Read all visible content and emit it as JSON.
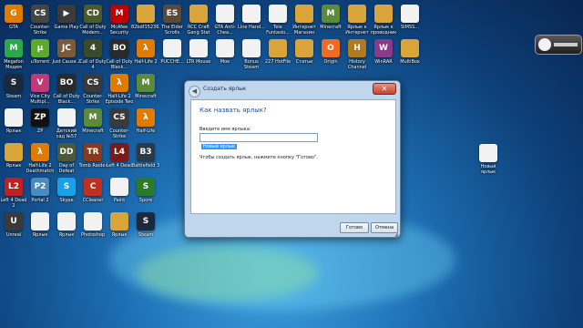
{
  "dialog": {
    "title": "Создать ярлык",
    "close_glyph": "✕",
    "back_glyph": "◀",
    "heading": "Как назвать ярлык?",
    "field_label": "Введите имя ярлыка:",
    "field_value": "Новый ярлык",
    "hint": "Чтобы создать ярлык, нажмите кнопку \"Готово\".",
    "done_label": "Готово",
    "cancel_label": "Отмена"
  },
  "colors": {
    "desktop_center": "#3fa3e0",
    "desktop_edge": "#082650",
    "dialog_frame": "#bfd6ec",
    "heading": "#1e4f94",
    "selection": "#3399ff",
    "close_button": "#c7412b"
  },
  "desktop_icons": [
    {
      "label": "GTA",
      "icon": "game-icon",
      "color": "#e07b00",
      "glyph": "G"
    },
    {
      "label": "Counter-Strike",
      "icon": "game-icon",
      "color": "#444444",
      "glyph": "CS"
    },
    {
      "label": "Game Play",
      "icon": "game-icon",
      "color": "#3b3b3b",
      "glyph": "▶"
    },
    {
      "label": "Call of Duty Modern...",
      "icon": "game-icon",
      "color": "#4a5a2a",
      "glyph": "CD"
    },
    {
      "label": "McAfee Security Sc...",
      "icon": "shield-icon",
      "color": "#c00000",
      "glyph": "M"
    },
    {
      "label": "82bdf15236...",
      "icon": "folder-icon",
      "color": "#d9a43a",
      "glyph": ""
    },
    {
      "label": "The Elder Scrolls",
      "icon": "game-icon",
      "color": "#5a4a3a",
      "glyph": "ES"
    },
    {
      "label": "RCC Craft Gang Stat",
      "icon": "folder-icon",
      "color": "#d9a43a",
      "glyph": ""
    },
    {
      "label": "GTA Anti-Chea...",
      "icon": "file-icon",
      "color": "#f2f2f2",
      "glyph": ""
    },
    {
      "label": "Line Hand...",
      "icon": "file-icon",
      "color": "#f2f2f2",
      "glyph": ""
    },
    {
      "label": "Tele Funtasio...",
      "icon": "file-icon",
      "color": "#f2f2f2",
      "glyph": ""
    },
    {
      "label": "Интернет Магазин",
      "icon": "folder-icon",
      "color": "#d9a43a",
      "glyph": ""
    },
    {
      "label": "Minecraft",
      "icon": "game-icon",
      "color": "#5a8a3a",
      "glyph": "M"
    },
    {
      "label": "Ярлык к Интернет",
      "icon": "folder-icon",
      "color": "#d9a43a",
      "glyph": ""
    },
    {
      "label": "Ярлык к проводник",
      "icon": "folder-icon",
      "color": "#d9a43a",
      "glyph": ""
    },
    {
      "label": "SIMSS...",
      "icon": "file-icon",
      "color": "#f2f2f2",
      "glyph": ""
    },
    {
      "label": "Megafon Модем",
      "icon": "modem-icon",
      "color": "#2aa84a",
      "glyph": "M"
    },
    {
      "label": "uTorrent",
      "icon": "torrent-icon",
      "color": "#5aab2a",
      "glyph": "µ"
    },
    {
      "label": "Just Cause 2",
      "icon": "game-icon",
      "color": "#7a5a3a",
      "glyph": "JC"
    },
    {
      "label": "Call of Duty 4",
      "icon": "game-icon",
      "color": "#3a4a2a",
      "glyph": "4"
    },
    {
      "label": "Call of Duty Black...",
      "icon": "game-icon",
      "color": "#2a2a2a",
      "glyph": "BO"
    },
    {
      "label": "Half-Life 2",
      "icon": "halflife-icon",
      "color": "#e07b00",
      "glyph": "λ"
    },
    {
      "label": "PUCCHE...",
      "icon": "file-icon",
      "color": "#f2f2f2",
      "glyph": ""
    },
    {
      "label": "LTR Mouse",
      "icon": "file-icon",
      "color": "#f2f2f2",
      "glyph": ""
    },
    {
      "label": "Moe",
      "icon": "file-icon",
      "color": "#f2f2f2",
      "glyph": ""
    },
    {
      "label": "Bonus Steam",
      "icon": "file-icon",
      "color": "#f2f2f2",
      "glyph": ""
    },
    {
      "label": "227 HotFile",
      "icon": "folder-icon",
      "color": "#d9a43a",
      "glyph": ""
    },
    {
      "label": "Статьи",
      "icon": "folder-icon",
      "color": "#d9a43a",
      "glyph": ""
    },
    {
      "label": "Origin",
      "icon": "origin-icon",
      "color": "#f06a1f",
      "glyph": "O"
    },
    {
      "label": "History Channel",
      "icon": "game-icon",
      "color": "#b07a20",
      "glyph": "H"
    },
    {
      "label": "WinRAR",
      "icon": "archive-icon",
      "color": "#8a3a8a",
      "glyph": "W"
    },
    {
      "label": "MultiBox",
      "icon": "folder-icon",
      "color": "#d9a43a",
      "glyph": ""
    },
    {
      "label": "Steam",
      "icon": "steam-icon",
      "color": "#1a2a3a",
      "glyph": "S"
    },
    {
      "label": "Vice City Multipl...",
      "icon": "game-icon",
      "color": "#c03a7a",
      "glyph": "V"
    },
    {
      "label": "Call of Duty Black...",
      "icon": "game-icon",
      "color": "#2a2a2a",
      "glyph": "BO"
    },
    {
      "label": "Counter-Strike Online",
      "icon": "game-icon",
      "color": "#3a3a3a",
      "glyph": "CS"
    },
    {
      "label": "Half-Life 2 Episode Two",
      "icon": "halflife-icon",
      "color": "#e07b00",
      "glyph": "λ"
    },
    {
      "label": "Minecraft",
      "icon": "game-icon",
      "color": "#5a8a3a",
      "glyph": "M"
    },
    {
      "label": "Ярлык",
      "icon": "file-icon",
      "color": "#f2f2f2",
      "glyph": ""
    },
    {
      "label": "ZP",
      "icon": "game-icon",
      "color": "#111111",
      "glyph": "ZP"
    },
    {
      "label": "Детский сад №57",
      "icon": "file-icon",
      "color": "#f2f2f2",
      "glyph": ""
    },
    {
      "label": "Minecraft",
      "icon": "game-icon",
      "color": "#5a8a3a",
      "glyph": "M"
    },
    {
      "label": "Counter-Strike Source",
      "icon": "game-icon",
      "color": "#3a3a3a",
      "glyph": "CS"
    },
    {
      "label": "Half-Life",
      "icon": "halflife-icon",
      "color": "#e07b00",
      "glyph": "λ"
    },
    {
      "label": "Ярлык",
      "icon": "folder-icon",
      "color": "#d9a43a",
      "glyph": ""
    },
    {
      "label": "Half-Life 2 Deathmatch",
      "icon": "halflife-icon",
      "color": "#e07b00",
      "glyph": "λ"
    },
    {
      "label": "Day of Defeat Source",
      "icon": "game-icon",
      "color": "#4a5a3a",
      "glyph": "DD"
    },
    {
      "label": "Tomb Raider",
      "icon": "game-icon",
      "color": "#8a3a1a",
      "glyph": "TR"
    },
    {
      "label": "Left 4 Dead",
      "icon": "game-icon",
      "color": "#7a1a1a",
      "glyph": "L4"
    },
    {
      "label": "Battlefield 3",
      "icon": "game-icon",
      "color": "#2a3a4a",
      "glyph": "B3"
    },
    {
      "label": "Left 4 Dead 2",
      "icon": "game-icon",
      "color": "#c02020",
      "glyph": "L2"
    },
    {
      "label": "Portal 2",
      "icon": "game-icon",
      "color": "#4a8ac0",
      "glyph": "P2"
    },
    {
      "label": "Skype",
      "icon": "skype-icon",
      "color": "#1aa0e8",
      "glyph": "S"
    },
    {
      "label": "CCleaner",
      "icon": "ccleaner-icon",
      "color": "#c03020",
      "glyph": "C"
    },
    {
      "label": "Paint",
      "icon": "file-icon",
      "color": "#f2f2f2",
      "glyph": ""
    },
    {
      "label": "Spore",
      "icon": "game-icon",
      "color": "#2a7a2a",
      "glyph": "S"
    },
    {
      "label": "Unreal",
      "icon": "game-icon",
      "color": "#3a3a3a",
      "glyph": "U"
    },
    {
      "label": "Ярлык",
      "icon": "file-icon",
      "color": "#f2f2f2",
      "glyph": ""
    },
    {
      "label": "Ярлык",
      "icon": "file-icon",
      "color": "#f2f2f2",
      "glyph": ""
    },
    {
      "label": "Photoshop",
      "icon": "file-icon",
      "color": "#f2f2f2",
      "glyph": ""
    },
    {
      "label": "Ярлык",
      "icon": "folder-icon",
      "color": "#d9a43a",
      "glyph": ""
    },
    {
      "label": "Steam",
      "icon": "steam-icon",
      "color": "#1a2a3a",
      "glyph": "S"
    }
  ],
  "right_icon": {
    "label": "Новый ярлык",
    "icon": "file-icon"
  }
}
